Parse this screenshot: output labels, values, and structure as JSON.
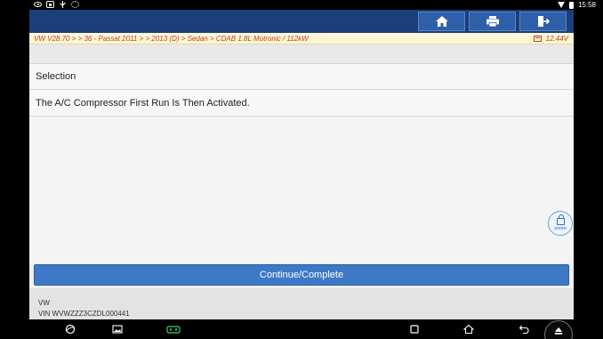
{
  "status_bar": {
    "left_icons": [
      "eye-icon",
      "screenshot-icon",
      "usb-icon",
      "settings-icon"
    ],
    "right_icons": [
      "wifi-icon",
      "battery-icon"
    ],
    "time": "15:58"
  },
  "toolbar": {
    "buttons": [
      {
        "name": "home-button",
        "icon": "home-icon"
      },
      {
        "name": "print-button",
        "icon": "printer-icon"
      },
      {
        "name": "exit-button",
        "icon": "exit-icon"
      }
    ]
  },
  "breadcrumb": {
    "path": "VW V28.70 > > 36 - Passat 2011 > > 2013 (D) > Sedan > CDAB 1.8L Motronic / 112kW",
    "voltage": "12.44V"
  },
  "main": {
    "heading": "Selection",
    "message": "The A/C Compressor First Run Is Then Activated.",
    "zoom_label": "zoom",
    "continue_label": "Continue/Complete"
  },
  "vehicle": {
    "make": "VW",
    "vin": "VIN WVWZZZ3CZDL000441"
  },
  "nav_bar": {
    "icons": [
      "browser-icon",
      "gallery-icon",
      "vci-icon",
      "recents-icon",
      "home-icon",
      "back-icon",
      "eject-icon"
    ]
  },
  "colors": {
    "toolbar": "#1b3f7a",
    "toolbar_button": "#2f5fa8",
    "breadcrumb_bg": "#fdf6d5",
    "breadcrumb_text": "#b8411f",
    "continue_button": "#3d79c6"
  }
}
